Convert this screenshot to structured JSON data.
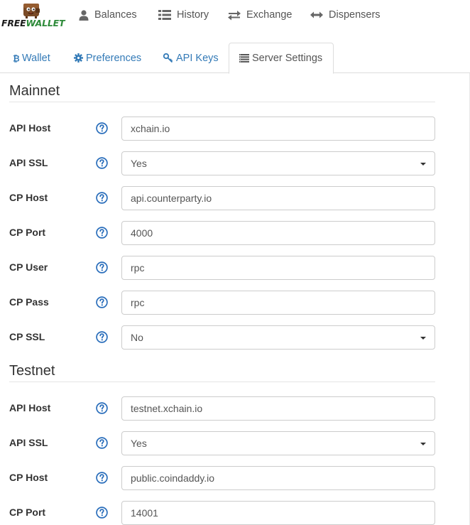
{
  "logo": {
    "text_part1": "FREE",
    "text_part2": "WALLET",
    "icon": "wallet-character-icon"
  },
  "nav": [
    {
      "label": "Balances",
      "icon": "user-icon"
    },
    {
      "label": "History",
      "icon": "list-icon"
    },
    {
      "label": "Exchange",
      "icon": "exchange-arrows-icon"
    },
    {
      "label": "Dispensers",
      "icon": "horizontal-arrows-icon"
    }
  ],
  "tabs": [
    {
      "label": "Wallet",
      "icon": "bitcoin-icon",
      "active": false
    },
    {
      "label": "Preferences",
      "icon": "gear-icon",
      "active": false
    },
    {
      "label": "API Keys",
      "icon": "key-icon",
      "active": false
    },
    {
      "label": "Server Settings",
      "icon": "server-list-icon",
      "active": true
    }
  ],
  "mainnet": {
    "title": "Mainnet",
    "fields": [
      {
        "label": "API Host",
        "type": "text",
        "value": "xchain.io"
      },
      {
        "label": "API SSL",
        "type": "select",
        "value": "Yes"
      },
      {
        "label": "CP Host",
        "type": "text",
        "value": "api.counterparty.io"
      },
      {
        "label": "CP Port",
        "type": "text",
        "value": "4000"
      },
      {
        "label": "CP User",
        "type": "text",
        "value": "rpc"
      },
      {
        "label": "CP Pass",
        "type": "text",
        "value": "rpc"
      },
      {
        "label": "CP SSL",
        "type": "select",
        "value": "No"
      }
    ]
  },
  "testnet": {
    "title": "Testnet",
    "fields": [
      {
        "label": "API Host",
        "type": "text",
        "value": "testnet.xchain.io"
      },
      {
        "label": "API SSL",
        "type": "select",
        "value": "Yes"
      },
      {
        "label": "CP Host",
        "type": "text",
        "value": "public.coindaddy.io"
      },
      {
        "label": "CP Port",
        "type": "text",
        "value": "14001"
      }
    ]
  },
  "colors": {
    "link": "#337ab7",
    "help_icon": "#2a6ebb",
    "logo_green": "#2e8b3a",
    "border": "#dddddd"
  }
}
